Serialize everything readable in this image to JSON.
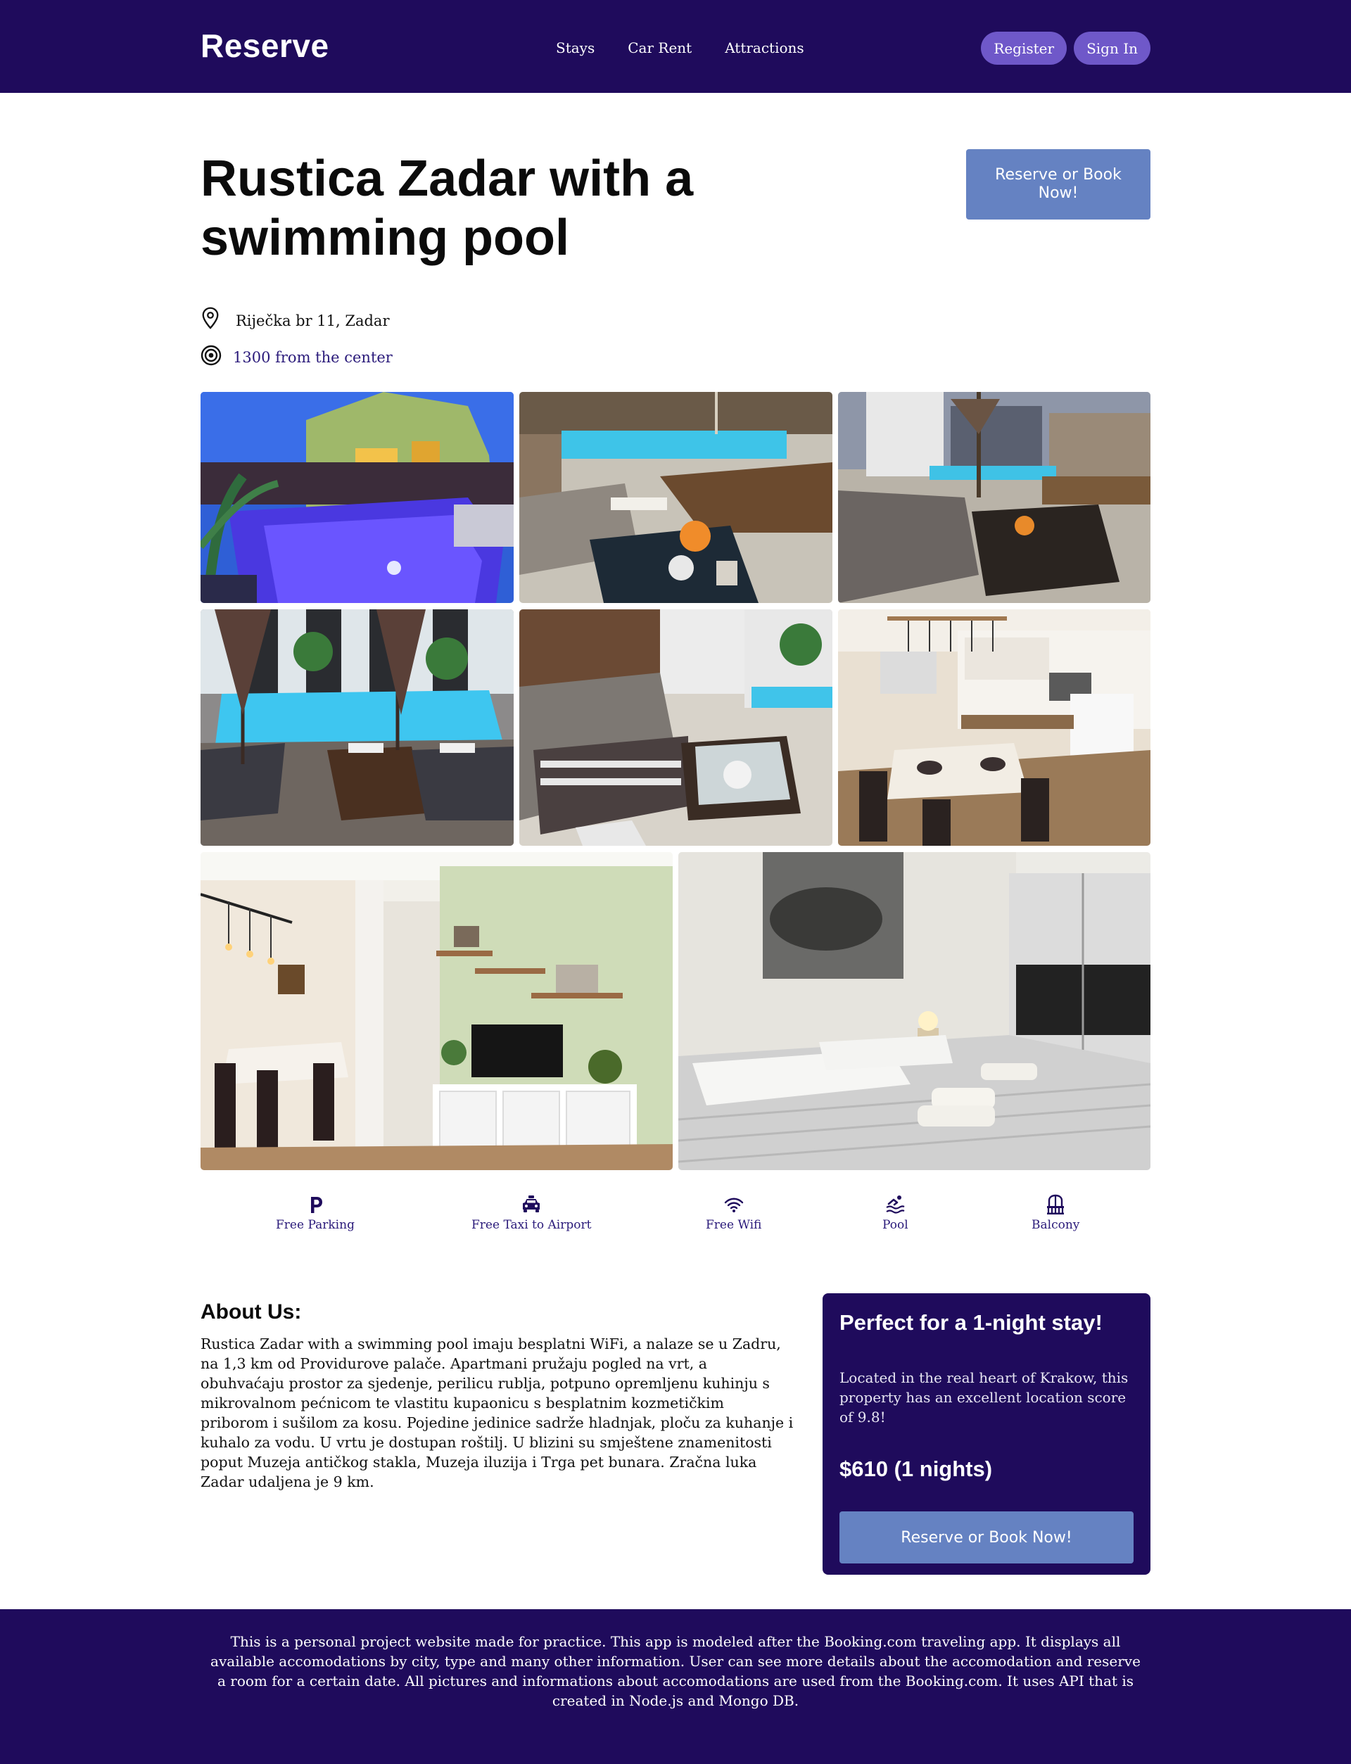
{
  "navbar": {
    "logo": "Reserve",
    "links": [
      "Stays",
      "Car Rent",
      "Attractions"
    ],
    "register_label": "Register",
    "signin_label": "Sign In"
  },
  "hotel": {
    "title": "Rustica Zadar with a swimming pool",
    "book_label": "Reserve or Book Now!",
    "address": "Riječka br 11, Zadar",
    "distance": "1300 from the center"
  },
  "gallery": {
    "photos": [
      "pool-night",
      "pool-lounge-table",
      "pool-lounge-wide",
      "pool-umbrellas",
      "terrace-sofa",
      "kitchen-dining",
      "living-room",
      "bedroom"
    ]
  },
  "amenities": [
    {
      "label": "Free Parking",
      "icon": "parking-icon"
    },
    {
      "label": "Free Taxi to Airport",
      "icon": "taxi-icon"
    },
    {
      "label": "Free Wifi",
      "icon": "wifi-icon"
    },
    {
      "label": "Pool",
      "icon": "pool-icon"
    },
    {
      "label": "Balcony",
      "icon": "balcony-icon"
    }
  ],
  "about": {
    "title": "About Us:",
    "text": "Rustica Zadar with a swimming pool imaju besplatni WiFi, a nalaze se u Zadru, na 1,3 km od Providurove palače. Apartmani pružaju pogled na vrt, a obuhvaćaju prostor za sjedenje, perilicu rublja, potpuno opremljenu kuhinju s mikrovalnom pećnicom te vlastitu kupaonicu s besplatnim kozmetičkim priborom i sušilom za kosu. Pojedine jedinice sadrže hladnjak, ploču za kuhanje i kuhalo za vodu. U vrtu je dostupan roštilj. U blizini su smještene znamenitosti poput Muzeja antičkog stakla, Muzeja iluzija i Trga pet bunara. Zračna luka Zadar udaljena je 9 km."
  },
  "card": {
    "title": "Perfect for a 1-night stay!",
    "description": "Located in the real heart of Krakow, this property has an excellent location score of 9.8!",
    "price": "$610 (1 nights)",
    "button_label": "Reserve or Book Now!"
  },
  "footer": {
    "text": "This is a personal project website made for practice. This app is modeled after the Booking.com traveling app. It displays all available accomodations by city, type and many other information. User can see more details about the accomodation and reserve a room for a certain date. All pictures and informations about accomodations are used from the Booking.com. It uses API that is created in Node.js and Mongo DB."
  },
  "colors": {
    "navy": "#1f0b5c",
    "button_blue": "#6582c2",
    "nav_button_purple": "#6f58c9",
    "link_purple": "#2a1a7a"
  }
}
